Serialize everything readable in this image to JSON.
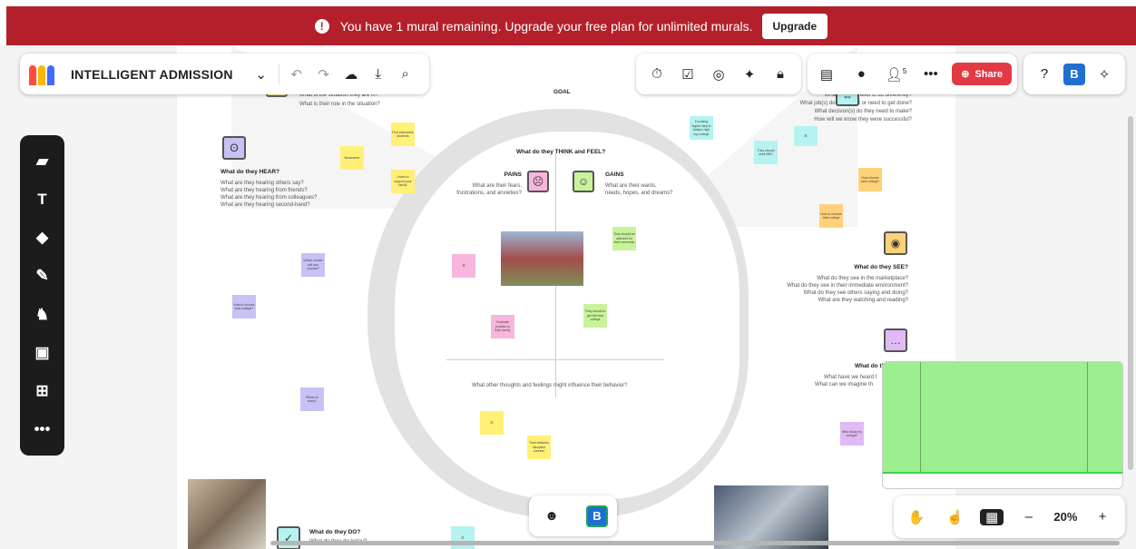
{
  "banner": {
    "message": "You have 1 mural remaining. Upgrade your free plan for unlimited murals.",
    "upgrade_label": "Upgrade",
    "color": "#b3202b"
  },
  "header": {
    "title": "INTELLIGENT ADMISSION",
    "icons": [
      "chevron-down-icon",
      "undo-icon",
      "redo-icon",
      "cloud-saved-icon",
      "download-icon",
      "search-icon"
    ]
  },
  "toolbar_mid": {
    "icons": [
      "timer-icon",
      "voting-icon",
      "private-mode-icon",
      "laser-pointer-icon",
      "lock-icon"
    ]
  },
  "toolbar_right": {
    "participants_count": "5",
    "share_label": "Share",
    "share_color": "#e23a44",
    "avatar_initial": "B"
  },
  "left_tools": [
    "sticky-note-icon",
    "text-icon",
    "shapes-icon",
    "pen-icon",
    "templates-llama-icon",
    "image-icon",
    "grid-icon",
    "more-icon"
  ],
  "zoom": {
    "value": "20%",
    "minus": "–",
    "plus": "+"
  },
  "react_avatar": "B",
  "board": {
    "goal": "GOAL",
    "think_feel": "What do they THINK and FEEL?",
    "pains_title": "PAINS",
    "pains_desc1": "What are their fears,",
    "pains_desc2": "frustrations, and anxieties?",
    "gains_title": "GAINS",
    "gains_desc1": "What are their wants,",
    "gains_desc2": "needs, hopes, and dreams?",
    "influence": "What other thoughts and feelings might influence their behavior?",
    "hear_title": "What do they HEAR?",
    "hear_lines": [
      "What are they hearing others say?",
      "What are they hearing from friends?",
      "What are they hearing from colleagues?",
      "What are they hearing second-hand?"
    ],
    "see_title": "What do they SEE?",
    "see_lines": [
      "What do they see in the marketplace?",
      "What do they see in their immediate environment?",
      "What do they see others saying and doing?",
      "What are they watching and reading?"
    ],
    "do_title": "What do they DO?",
    "do_line": "What do they do today?",
    "topleft_lines": [
      "What is the situation they are in?",
      "What is their role in the situation?"
    ],
    "topright_lines": [
      "What do they need to do differently?",
      "What job(s) do they want or need to get done?",
      "What decision(s) do they need to make?",
      "How will we know they were successful?"
    ],
    "partial_right_title": "What do th",
    "partial_right_lines": [
      "What have we heard t",
      "What can we imagine th"
    ],
    "stickies": {
      "s1": "Bookname",
      "s2": "Find elsewhere students",
      "s3": "Listen to support your family",
      "s4": "Which course will you choose?",
      "s5": "How to choose best college?",
      "s6": "Where to study?",
      "s7": "Evaluate problem in their family",
      "s8": "They should be selected for their university",
      "s9": "They should to get the best college",
      "s10": "Time between discipline courses",
      "s11": "Focusing higher step in today's high top college",
      "s12": "They should seek BRC",
      "s13": "How choose best college?",
      "s14": "How to choose best college",
      "s15": "Who study my college?"
    }
  }
}
